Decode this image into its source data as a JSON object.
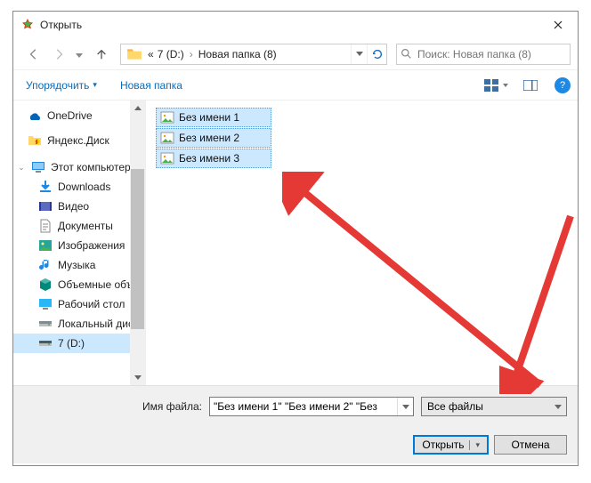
{
  "title": "Открыть",
  "nav": {
    "crumb0": "«",
    "crumb1": "7 (D:)",
    "crumb2": "Новая папка (8)"
  },
  "search": {
    "placeholder": "Поиск: Новая папка (8)"
  },
  "toolbar": {
    "organize": "Упорядочить",
    "newfolder": "Новая папка",
    "help": "?"
  },
  "sidebar": {
    "items": [
      {
        "icon": "onedrive",
        "label": "OneDrive"
      },
      {
        "icon": "yadisk",
        "label": "Яндекс.Диск"
      },
      {
        "icon": "thispc",
        "label": "Этот компьютер",
        "expandable": true
      },
      {
        "icon": "downloads",
        "label": "Downloads"
      },
      {
        "icon": "videos",
        "label": "Видео"
      },
      {
        "icon": "documents",
        "label": "Документы"
      },
      {
        "icon": "pictures",
        "label": "Изображения"
      },
      {
        "icon": "music",
        "label": "Музыка"
      },
      {
        "icon": "volumes",
        "label": "Объемные объекты"
      },
      {
        "icon": "desktop",
        "label": "Рабочий стол"
      },
      {
        "icon": "drive",
        "label": "Локальный диск"
      },
      {
        "icon": "drive7",
        "label": "7 (D:)",
        "selected": true
      }
    ]
  },
  "files": [
    {
      "label": "Без имени 1"
    },
    {
      "label": "Без имени 2"
    },
    {
      "label": "Без имени 3"
    }
  ],
  "footer": {
    "filename_label": "Имя файла:",
    "filename_value": "\"Без имени 1\" \"Без имени 2\" \"Без",
    "filter": "Все файлы",
    "open": "Открыть",
    "cancel": "Отмена"
  }
}
